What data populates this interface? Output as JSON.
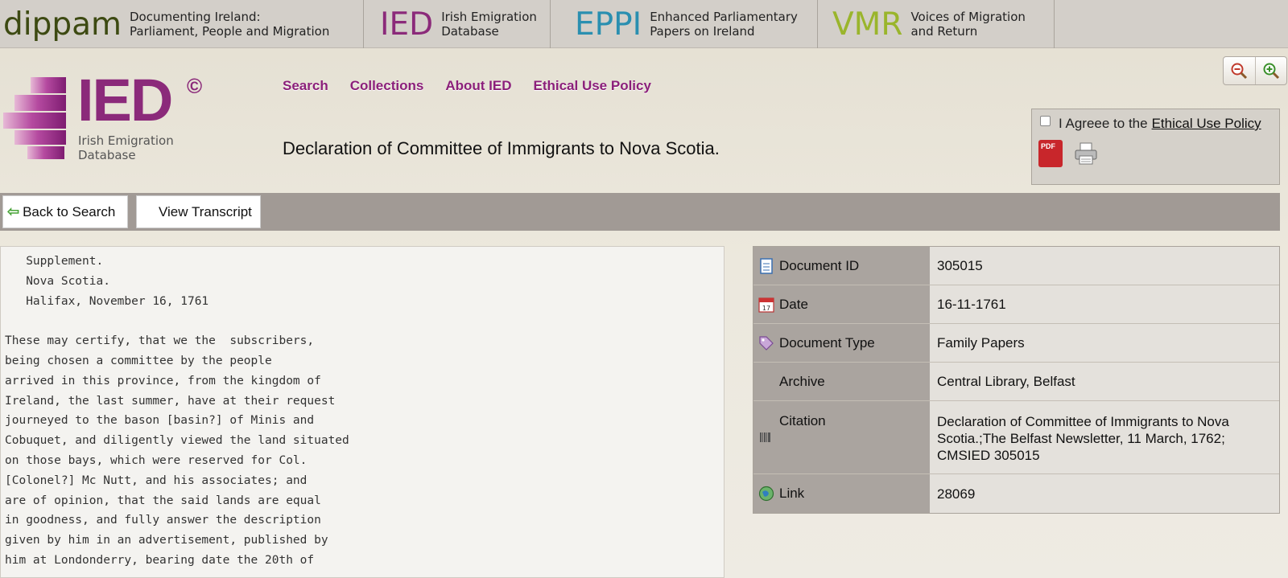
{
  "topbar": {
    "dippam": {
      "brand": "dippam",
      "line1": "Documenting Ireland:",
      "line2": "Parliament, People and Migration"
    },
    "ied": {
      "brand": "IED",
      "line1": "Irish Emigration",
      "line2": "Database"
    },
    "eppi": {
      "brand": "EPPI",
      "line1": "Enhanced Parliamentary",
      "line2": "Papers on Ireland"
    },
    "vmr": {
      "brand": "VMR",
      "line1": "Voices of Migration",
      "line2": "and Return"
    }
  },
  "logo": {
    "title": "IED",
    "copyright": "©",
    "subtitle": "Irish Emigration Database"
  },
  "nav": [
    "Search",
    "Collections",
    "About IED",
    "Ethical Use Policy"
  ],
  "page_title": "Declaration of Committee of Immigrants to Nova Scotia.",
  "agree": {
    "text": "I Agreee to the",
    "link": "Ethical Use Policy",
    "pdf_label": "PDF"
  },
  "toolbar": {
    "back_label": "Back to Search",
    "view_label": "View Transcript"
  },
  "transcript": [
    "   Supplement.",
    "   Nova Scotia.",
    "   Halifax, November 16, 1761",
    "",
    "These may certify, that we the  subscribers,",
    "being chosen a committee by the people",
    "arrived in this province, from the kingdom of",
    "Ireland, the last summer, have at their request",
    "journeyed to the bason [basin?] of Minis and",
    "Cobuquet, and diligently viewed the land situated",
    "on those bays, which were reserved for Col.",
    "[Colonel?] Mc Nutt, and his associates; and",
    "are of opinion, that the said lands are equal",
    "in goodness, and fully answer the description",
    "given by him in an advertisement, published by",
    "him at Londonderry, bearing date the 20th of"
  ],
  "meta": {
    "doc_id": {
      "label": "Document ID",
      "value": "305015",
      "icon": "document-icon"
    },
    "date": {
      "label": "Date",
      "value": "16-11-1761",
      "icon": "calendar-icon"
    },
    "doc_type": {
      "label": "Document Type",
      "value": "Family Papers",
      "icon": "tag-icon"
    },
    "archive": {
      "label": "Archive",
      "value": "Central Library, Belfast"
    },
    "citation": {
      "label": "Citation",
      "value": "Declaration of Committee of Immigrants to Nova Scotia.;The Belfast Newsletter, 11 March, 1762; CMSIED 305015",
      "icon": "barcode-icon"
    },
    "link": {
      "label": "Link",
      "value": "28069",
      "icon": "globe-icon"
    }
  },
  "colors": {
    "accent": "#8b1f7a",
    "toolbar": "#a19a95",
    "label_bg": "#aaa49f"
  }
}
